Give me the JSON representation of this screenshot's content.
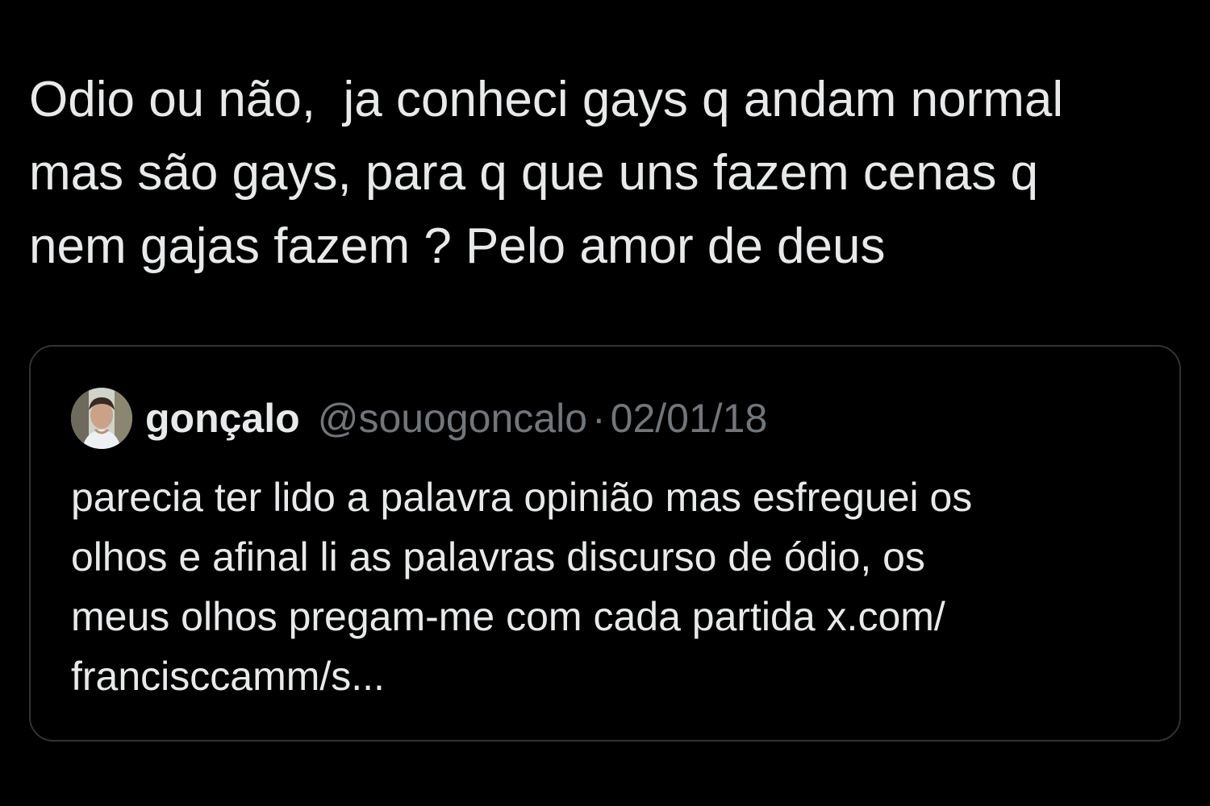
{
  "tweet": {
    "text": "Odio ou não,  ja conheci gays q andam normal\nmas são gays, para q que uns fazem cenas q\nnem gajas fazem ? Pelo amor de deus"
  },
  "quoted_tweet": {
    "display_name": "gonçalo",
    "handle": "@souogoncalo",
    "separator": "·",
    "date": "02/01/18",
    "text": "parecia ter lido a palavra opinião mas esfreguei os\nolhos e afinal li as palavras discurso de ódio, os\nmeus olhos pregam-me com cada partida x.com/\nfrancisccamm/s...",
    "avatar": "avatar-photo"
  },
  "colors": {
    "background": "#000000",
    "primary_text": "#e7e9ea",
    "secondary_text": "#71767b",
    "card_border": "#2f3336"
  }
}
